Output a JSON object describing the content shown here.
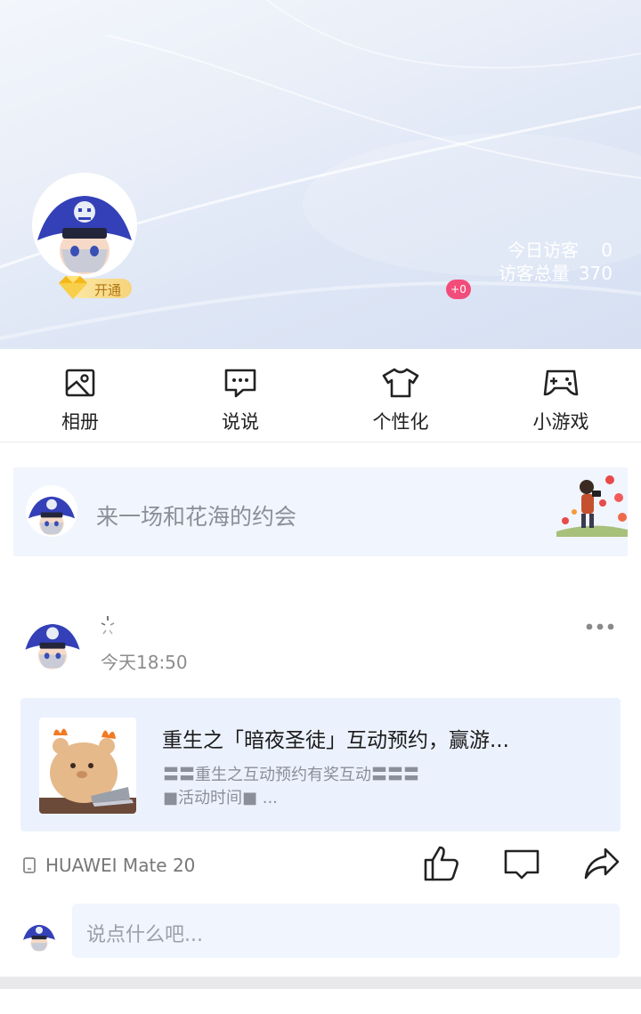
{
  "header": {
    "vip_label": "开通",
    "visitors_today_label": "今日访客",
    "visitors_today": "0",
    "visitors_total_label": "访客总量",
    "visitors_total": "370",
    "new_badge": "+0"
  },
  "quick_nav": [
    {
      "label": "相册",
      "icon": "photo-album-icon"
    },
    {
      "label": "说说",
      "icon": "message-bubble-icon"
    },
    {
      "label": "个性化",
      "icon": "tshirt-icon"
    },
    {
      "label": "小游戏",
      "icon": "gamepad-icon"
    }
  ],
  "composer": {
    "prompt": "来一场和花海的约会"
  },
  "post": {
    "time": "今天18:50",
    "share_card": {
      "title": "重生之「暗夜圣徒」互动预约，赢游...",
      "desc_line1": "〓〓重生之互动预约有奖互动〓〓〓",
      "desc_line2": "■活动时间■ ..."
    },
    "device": "HUAWEI Mate 20"
  },
  "reply": {
    "placeholder": "说点什么吧..."
  },
  "colors": {
    "accent_badge": "#f24d7a",
    "card_bg": "#ecf2fd",
    "vip_gold": "#f6d47a"
  }
}
